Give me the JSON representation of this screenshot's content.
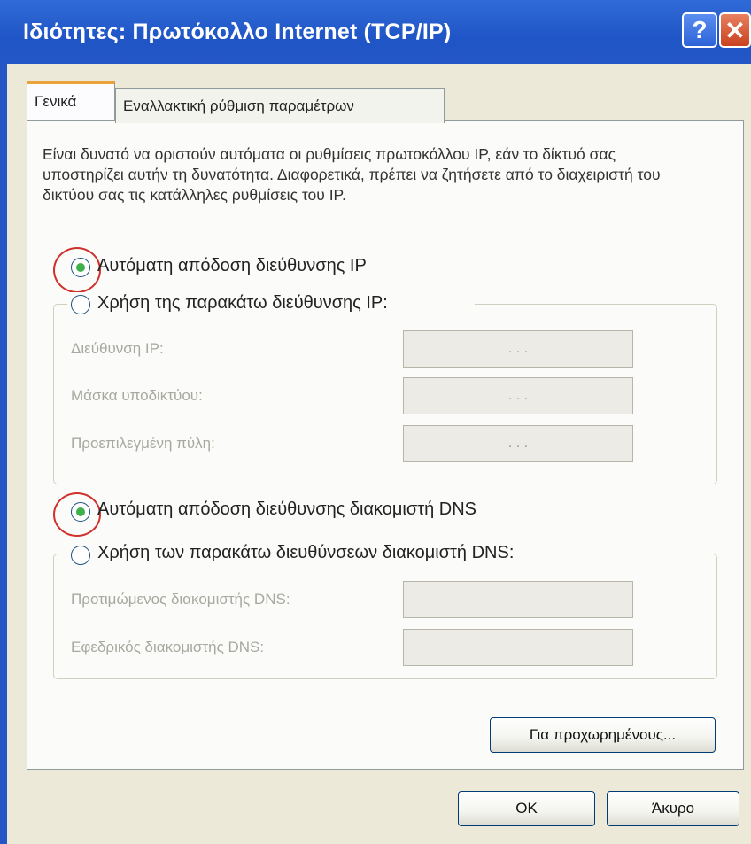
{
  "window": {
    "title": "Ιδιότητες: Πρωτόκολλο Internet (TCP/IP)",
    "help_glyph": "?",
    "close_glyph": "✕"
  },
  "tabs": [
    {
      "label": "Γενικά"
    },
    {
      "label": "Εναλλακτική ρύθμιση παραμέτρων"
    }
  ],
  "description": "Είναι δυνατό να οριστούν αυτόματα οι ρυθμίσεις πρωτοκόλλου IP, εάν το δίκτυό σας υποστηρίζει αυτήν τη δυνατότητα. Διαφορετικά, πρέπει να ζητήσετε από το διαχειριστή του δικτύου σας τις κατάλληλες ρυθμίσεις του IP.",
  "ip_section": {
    "auto_label": "Αυτόματη απόδοση διεύθυνσης IP",
    "auto_selected": true,
    "manual_label": "Χρήση της παρακάτω διεύθυνσης IP:",
    "fields": [
      {
        "label": "Διεύθυνση IP:",
        "value": ".   .   ."
      },
      {
        "label": "Μάσκα υποδικτύου:",
        "value": ".   .   ."
      },
      {
        "label": "Προεπιλεγμένη πύλη:",
        "value": ".   .   ."
      }
    ]
  },
  "dns_section": {
    "auto_label": "Αυτόματη απόδοση διεύθυνσης διακομιστή DNS",
    "auto_selected": true,
    "manual_label": "Χρήση των παρακάτω διευθύνσεων διακομιστή DNS:",
    "fields": [
      {
        "label": "Προτιμώμενος διακομιστής DNS:",
        "value": ""
      },
      {
        "label": "Εφεδρικός διακομιστής DNS:",
        "value": ""
      }
    ]
  },
  "buttons": {
    "advanced": "Για προχωρημένους...",
    "ok": "OK",
    "cancel": "Άκυρο"
  },
  "colors": {
    "titlebar": "#2456c6",
    "radio_selected": "#3fb04c",
    "highlight_ring": "#d0302a"
  }
}
